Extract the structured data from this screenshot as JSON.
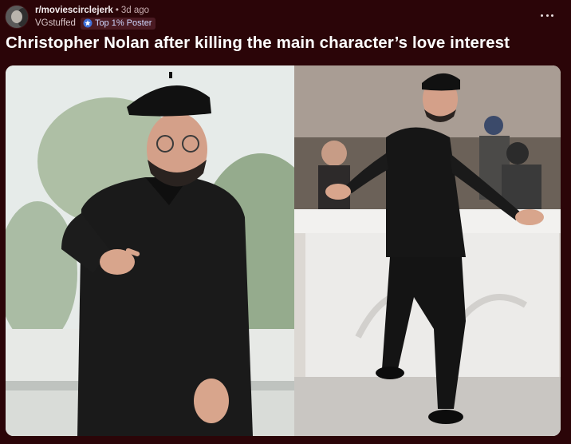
{
  "post": {
    "subreddit": "r/moviescirclejerk",
    "separator": "•",
    "time_ago": "3d ago",
    "username": "VGstuffed",
    "flair": "Top 1% Poster",
    "more_icon": "more-horizontal-icon",
    "title": "Christopher Nolan after killing the main character’s love interest"
  },
  "images": [
    {
      "name": "photo-left",
      "subject": "man in beret and black jacket pointing at camera"
    },
    {
      "name": "photo-right",
      "subject": "man in beret posing at photocall with photographers behind"
    }
  ],
  "colors": {
    "background": "#2b0508",
    "title": "#ffffff",
    "meta": "#c9aeb2",
    "flair_bg": "#4a1a22",
    "flair_text": "#cfd8ff"
  }
}
